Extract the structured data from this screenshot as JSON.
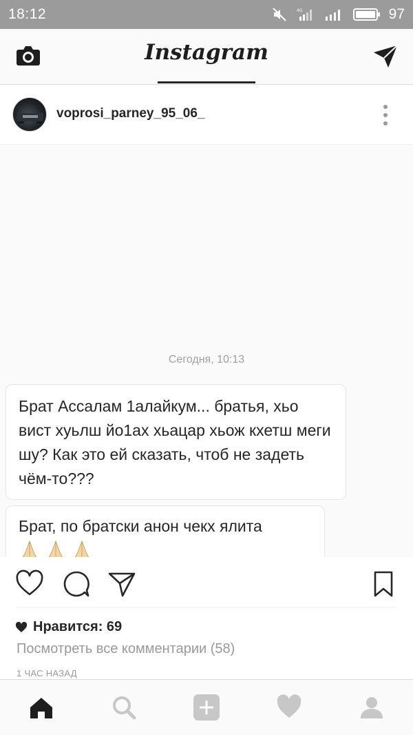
{
  "status_bar": {
    "time": "18:12",
    "network_type": "4G",
    "battery_level": "97"
  },
  "app_bar": {
    "logo_text": "Instagram"
  },
  "post": {
    "username": "voprosi_parney_95_06_",
    "screenshot_timestamp": "Сегодня, 10:13",
    "messages": [
      "Брат Ассалам 1алайкум... братья, хьо вист хуьлш йо1ах хьацар хьож кхетш меги шу? Как это ей сказать, чтоб не задеть чём-то???",
      "Брат, по братски анон чекх ялита"
    ],
    "likes_label": "Нравится: 69",
    "view_comments_label": "Посмотреть все комментарии (58)",
    "time_ago": "1 ЧАС НАЗАД"
  },
  "icons": {
    "camera": "camera-icon",
    "direct": "direct-send-icon",
    "more": "more-vertical-icon",
    "heart": "heart-outline-icon",
    "comment": "comment-icon",
    "share": "share-icon",
    "bookmark": "bookmark-icon",
    "home": "home-icon",
    "search": "search-icon",
    "add": "add-icon",
    "activity": "heart-filled-icon",
    "profile": "profile-icon"
  },
  "colors": {
    "status_bar": "#9b9b9b",
    "text": "#262626",
    "muted": "#999999",
    "message_bg": "#fafafa"
  }
}
